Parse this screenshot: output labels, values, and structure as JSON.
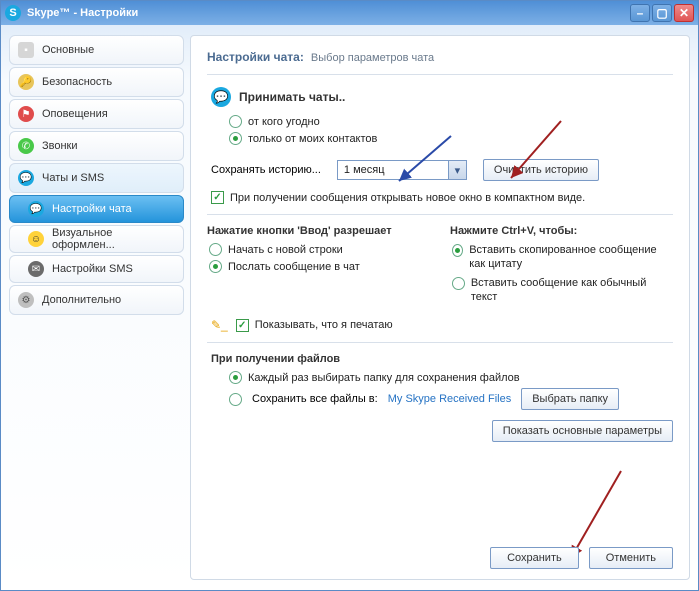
{
  "window": {
    "title": "Skype™ - Настройки"
  },
  "sidebar": {
    "items": [
      {
        "label": "Основные",
        "icon_bg": "#d6d6d6"
      },
      {
        "label": "Безопасность",
        "icon_bg": "#e8c55a"
      },
      {
        "label": "Оповещения",
        "icon_bg": "#e04c4c"
      },
      {
        "label": "Звонки",
        "icon_bg": "#49c949"
      },
      {
        "label": "Чаты и SMS",
        "icon_bg": "#1aa8e0"
      },
      {
        "label": "Настройки чата",
        "icon_bg": "#1aa8e0",
        "sub": true,
        "active": true
      },
      {
        "label": "Визуальное оформлен...",
        "icon_bg": "#ffd23a",
        "sub": true
      },
      {
        "label": "Настройки SMS",
        "icon_bg": "#6b6b6b",
        "sub": true
      },
      {
        "label": "Дополнительно",
        "icon_bg": "#bfbfbf"
      }
    ]
  },
  "header": {
    "title": "Настройки чата:",
    "subtitle": "Выбор параметров чата"
  },
  "accept": {
    "title": "Принимать чаты..",
    "anyone": "от кого угодно",
    "contacts_only": "только от моих контактов"
  },
  "history": {
    "label": "Сохранять историю...",
    "selected": "1 месяц",
    "clear_btn": "Очистить историю"
  },
  "compact_chk": "При получении сообщения открывать новое окно в компактном виде.",
  "enter": {
    "title": "Нажатие кнопки 'Ввод' разрешает",
    "newline": "Начать с новой строки",
    "send": "Послать сообщение в чат"
  },
  "ctrlv": {
    "title": "Нажмите Ctrl+V, чтобы:",
    "quote": "Вставить скопированное сообщение как цитату",
    "plain": "Вставить сообщение как обычный текст"
  },
  "typing_chk": "Показывать, что я печатаю",
  "files": {
    "title": "При получении файлов",
    "ask": "Каждый раз выбирать папку для сохранения файлов",
    "save_all": "Сохранить все файлы в:",
    "path": "My Skype Received Files",
    "choose_btn": "Выбрать папку"
  },
  "show_basic_btn": "Показать основные параметры",
  "footer": {
    "save": "Сохранить",
    "cancel": "Отменить"
  }
}
